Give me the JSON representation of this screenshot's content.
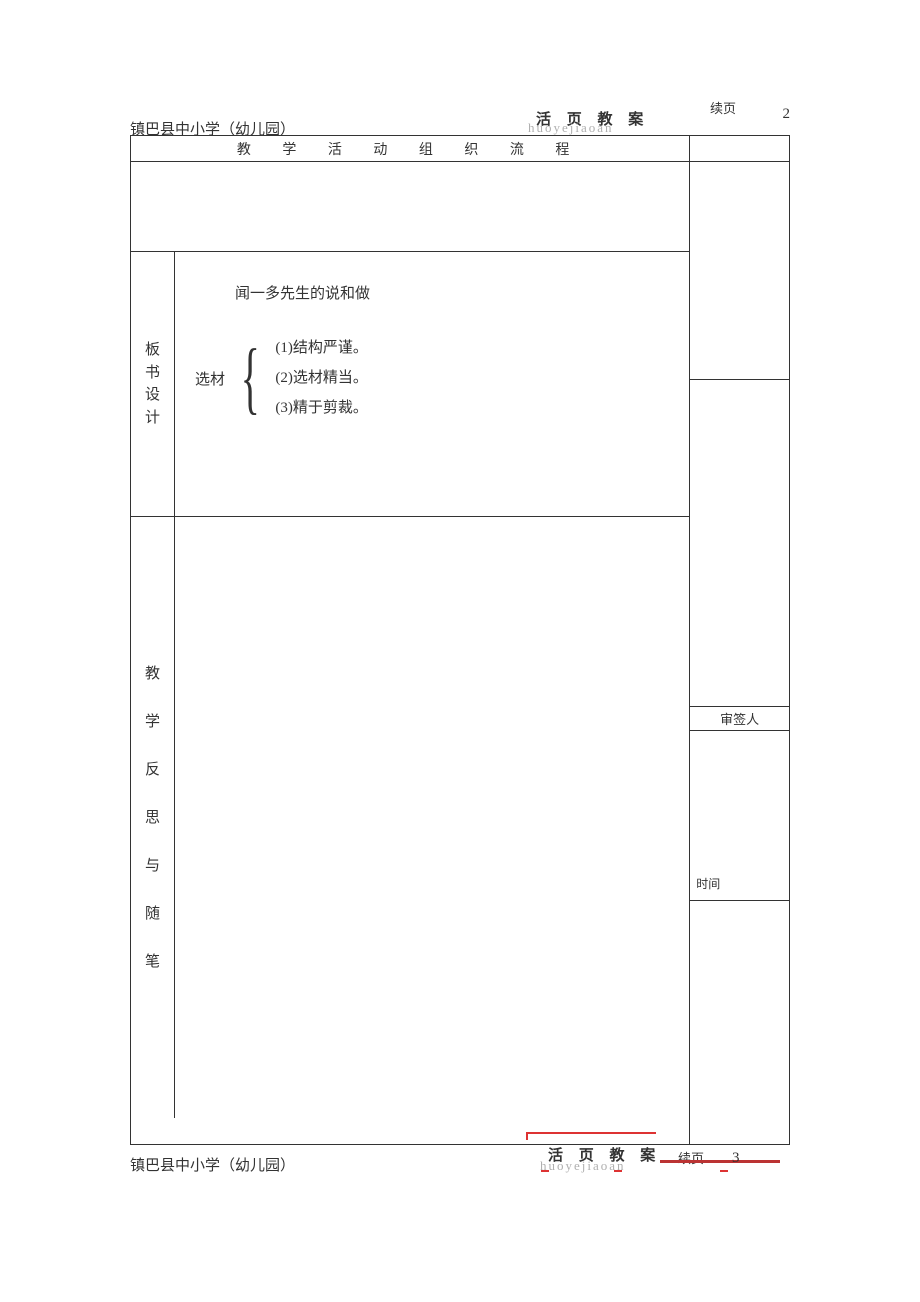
{
  "header": {
    "school": "镇巴县中小学（幼儿园）",
    "huoye_title": "活 页 教 案",
    "huoye_pinyin": "huoyejiaoan",
    "xuye": "续页",
    "page_number": "2"
  },
  "table": {
    "flow_header": "教 学 活 动 组 织 流 程",
    "banshu_label": "板书设计",
    "banshu": {
      "title": "闻一多先生的说和做",
      "material_label": "选材",
      "points": {
        "p1": "(1)结构严谨。",
        "p2": "(2)选材精当。",
        "p3": "(3)精于剪裁。"
      }
    },
    "fansi_label": "教学反思与随笔",
    "sidebar": {
      "shenqian": "审签人",
      "shijian": "时间"
    }
  },
  "footer": {
    "school": "镇巴县中小学（幼儿园）",
    "huoye_title": "活 页 教 案",
    "huoye_pinyin": "huoyejiaoan",
    "xuye": "续页",
    "page_number": "3"
  }
}
